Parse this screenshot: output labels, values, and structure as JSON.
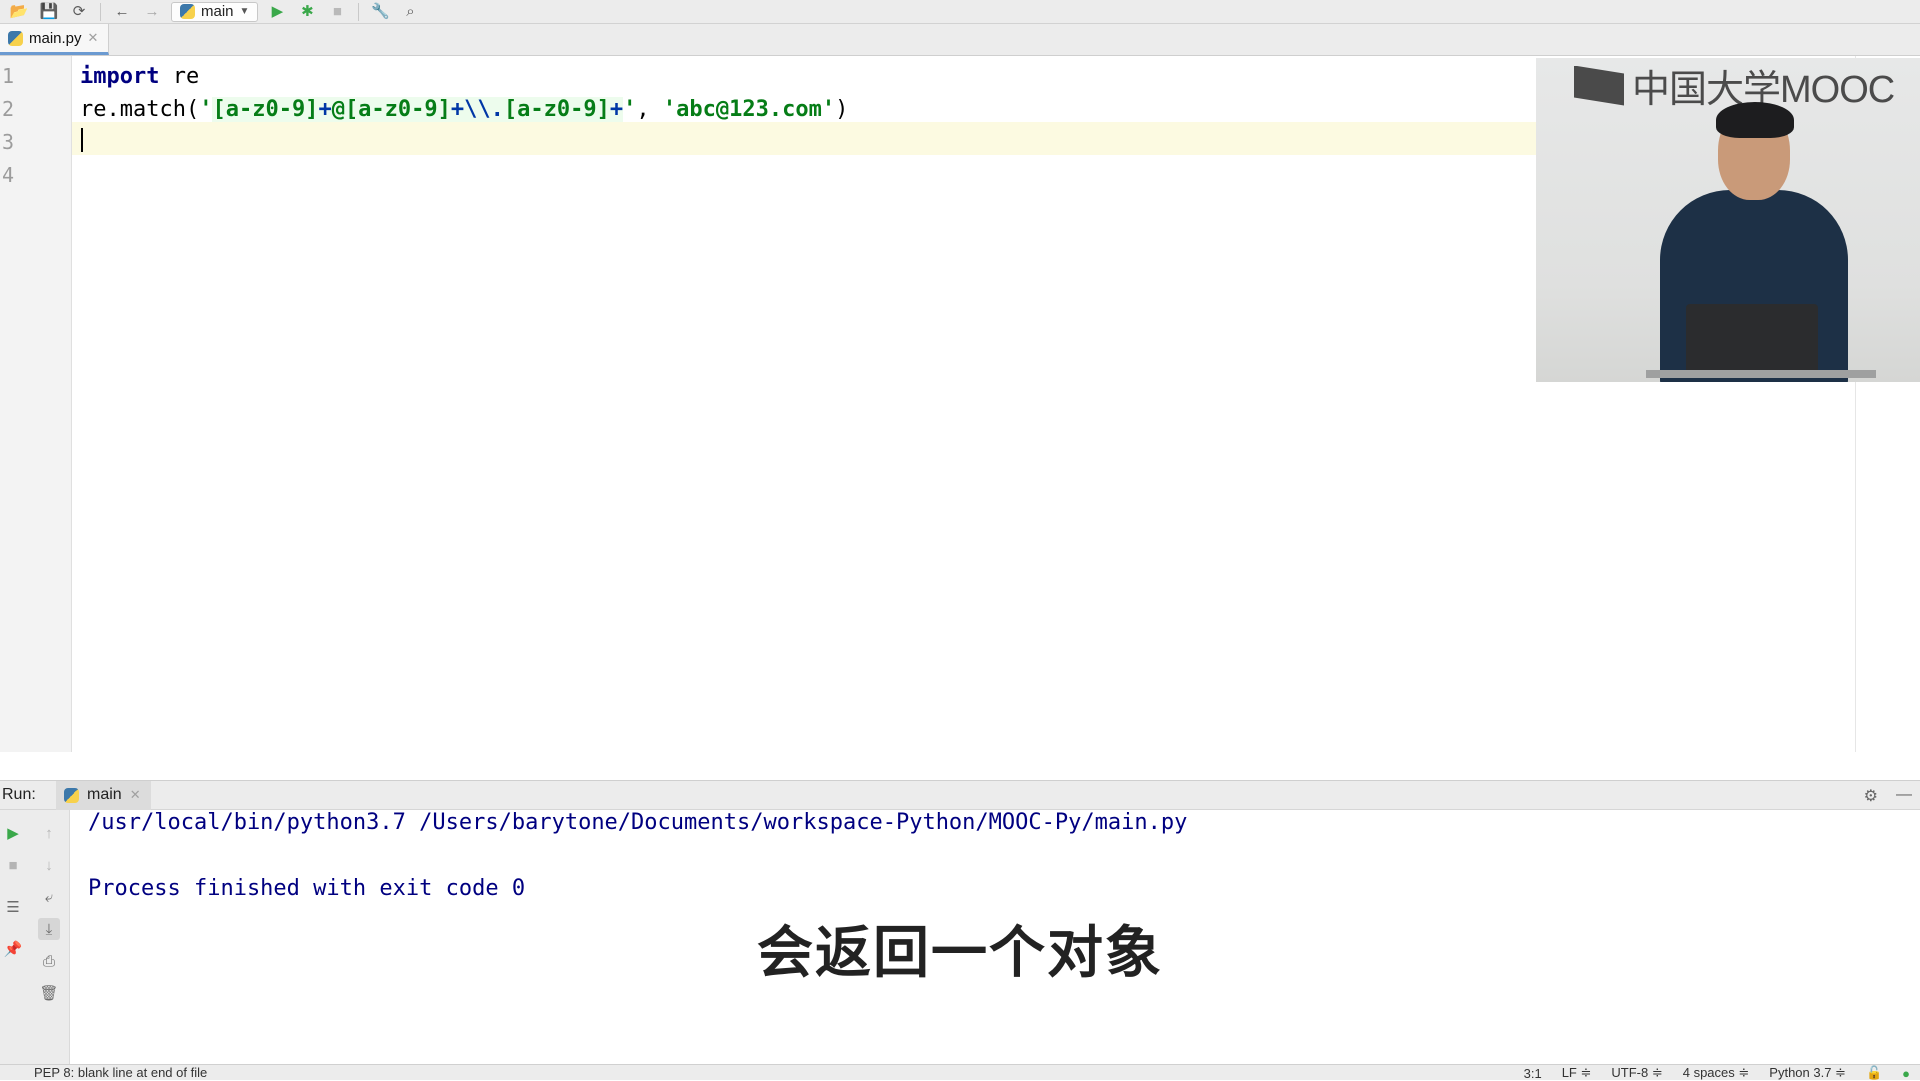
{
  "toolbar": {
    "run_config": "main",
    "icons": [
      "folder-open-icon",
      "save-icon",
      "sync-icon",
      "back-icon",
      "forward-icon",
      "run-icon",
      "debug-icon",
      "stop-icon",
      "wrench-icon",
      "search-icon"
    ]
  },
  "editor_tab": {
    "filename": "main.py"
  },
  "editor": {
    "line_numbers": [
      "1",
      "2",
      "3",
      "4"
    ],
    "line1": {
      "keyword": "import",
      "rest": " re"
    },
    "line2": {
      "prefix": "re.match(",
      "q1": "'",
      "rx1": "[a-z0-9]",
      "rx2": "+",
      "rx3": "@",
      "rx4": "[a-z0-9]",
      "rx5": "+",
      "rx6": "\\\\.",
      "rx7": "[a-z0-9]",
      "rx8": "+",
      "q2": "'",
      "sep": ", ",
      "arg2": "'abc@123.com'",
      "suffix": ")"
    }
  },
  "video": {
    "logo_text": "中国大学MOOC"
  },
  "run": {
    "label": "Run:",
    "tab": "main",
    "console": [
      "/usr/local/bin/python3.7 /Users/barytone/Documents/workspace-Python/MOOC-Py/main.py",
      "",
      "Process finished with exit code 0"
    ]
  },
  "subtitle": "会返回一个对象",
  "status": {
    "message": "PEP 8: blank line at end of file",
    "position": "3:1",
    "line_sep": "LF ≑",
    "encoding": "UTF-8 ≑",
    "indent": "4 spaces ≑",
    "interpreter": "Python 3.7 ≑"
  }
}
